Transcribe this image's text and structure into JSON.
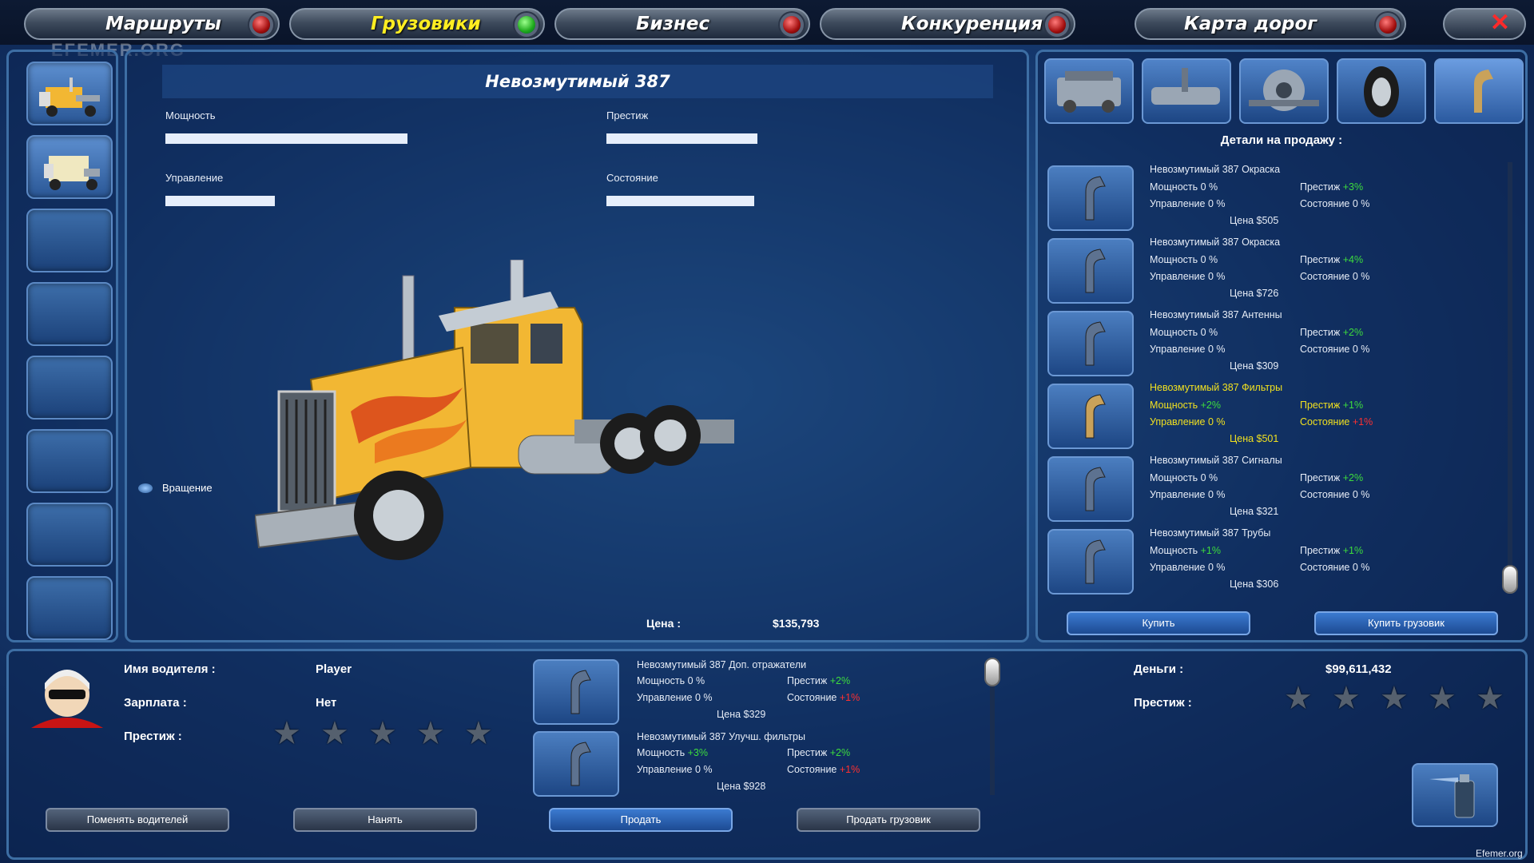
{
  "nav": {
    "tabs": [
      {
        "label": "Маршруты",
        "active": false
      },
      {
        "label": "Грузовики",
        "active": true
      },
      {
        "label": "Бизнес",
        "active": false
      },
      {
        "label": "Конкуренция",
        "active": false
      },
      {
        "label": "Карта дорог",
        "active": false
      }
    ],
    "watermark": "EFEMER.ORG"
  },
  "truck": {
    "name": "Невозмутимый 387",
    "stats": {
      "power_label": "Мощность",
      "power": 0.82,
      "prestige_label": "Престиж",
      "prestige": 0.51,
      "handling_label": "Управление",
      "handling": 0.37,
      "condition_label": "Состояние",
      "condition": 0.5
    },
    "rotate_label": "Вращение",
    "price_label": "Цена :",
    "price_value": "$135,793",
    "colors": {
      "body": "#f2b733",
      "flames": "#d9441a"
    }
  },
  "shop": {
    "title": "Детали на продажу :",
    "category_icons": [
      "engine-icon",
      "transmission-icon",
      "chassis-icon",
      "tire-icon",
      "exhaust-icon"
    ],
    "items": [
      {
        "name": "Невозмутимый 387 Окраска",
        "power": "Мощность 0 %",
        "prestige_label": "Престиж",
        "prestige": "+3%",
        "handling": "Управление 0 %",
        "condition_label": "Состояние",
        "condition": "0 %",
        "price": "Цена $505",
        "selected": false
      },
      {
        "name": "Невозмутимый 387 Окраска",
        "power": "Мощность 0 %",
        "prestige_label": "Престиж",
        "prestige": "+4%",
        "handling": "Управление 0 %",
        "condition_label": "Состояние",
        "condition": "0 %",
        "price": "Цена $726",
        "selected": false
      },
      {
        "name": "Невозмутимый 387 Антенны",
        "power": "Мощность 0 %",
        "prestige_label": "Престиж",
        "prestige": "+2%",
        "handling": "Управление 0 %",
        "condition_label": "Состояние",
        "condition": "0 %",
        "price": "Цена $309",
        "selected": false
      },
      {
        "name": "Невозмутимый 387 Фильтры",
        "power_label": "Мощность",
        "power_value": "+2%",
        "prestige_label": "Престиж",
        "prestige": "+1%",
        "handling": "Управление 0 %",
        "condition_label": "Состояние",
        "condition": "+1%",
        "price": "Цена $501",
        "selected": true
      },
      {
        "name": "Невозмутимый 387 Сигналы",
        "power": "Мощность 0 %",
        "prestige_label": "Престиж",
        "prestige": "+2%",
        "handling": "Управление 0 %",
        "condition_label": "Состояние",
        "condition": "0 %",
        "price": "Цена $321",
        "selected": false
      },
      {
        "name": "Невозмутимый 387 Трубы",
        "power_label": "Мощность",
        "power_value": "+1%",
        "prestige_label": "Престиж",
        "prestige": "+1%",
        "handling": "Управление 0 %",
        "condition_label": "Состояние",
        "condition": "0 %",
        "price": "Цена $306",
        "selected": false
      }
    ],
    "buy_label": "Купить",
    "buy_truck_label": "Купить грузовик"
  },
  "driver": {
    "name_label": "Имя водителя :",
    "name_value": "Player",
    "salary_label": "Зарплата :",
    "salary_value": "Нет",
    "prestige_label": "Престиж :",
    "prestige_stars": 0,
    "change_label": "Поменять водителей",
    "hire_label": "Нанять"
  },
  "installed": {
    "items": [
      {
        "name": "Невозмутимый 387 Доп. отражатели",
        "power": "Мощность 0 %",
        "prestige_label": "Престиж",
        "prestige": "+2%",
        "handling": "Управление 0 %",
        "condition_label": "Состояние",
        "condition": "+1%",
        "price": "Цена $329"
      },
      {
        "name": "Невозмутимый 387 Улучш. фильтры",
        "power_label": "Мощность",
        "power_value": "+3%",
        "prestige_label": "Престиж",
        "prestige": "+2%",
        "handling": "Управление 0 %",
        "condition_label": "Состояние",
        "condition": "+1%",
        "price": "Цена $928"
      }
    ],
    "sell_label": "Продать",
    "sell_truck_label": "Продать грузовик"
  },
  "finance": {
    "money_label": "Деньги :",
    "money_value": "$99,611,432",
    "prestige_label": "Престиж :",
    "prestige_stars": 0
  },
  "footer_watermark": "Efemer.org"
}
